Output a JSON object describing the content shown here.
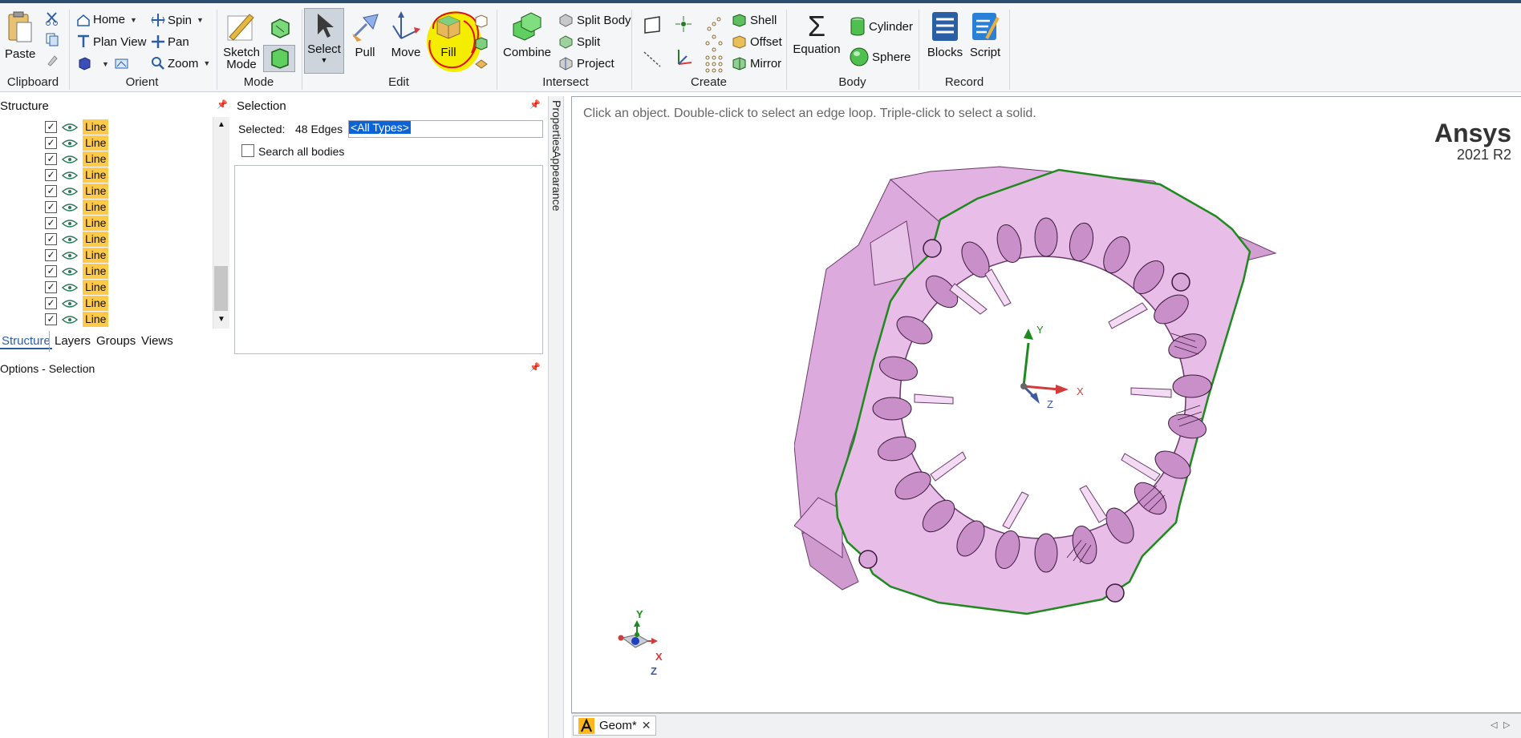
{
  "ribbon": {
    "clipboard": {
      "label": "Clipboard",
      "paste": "Paste"
    },
    "orient": {
      "label": "Orient",
      "home": "Home",
      "spin": "Spin",
      "plan_view": "Plan View",
      "pan": "Pan",
      "zoom": "Zoom"
    },
    "mode": {
      "label": "Mode",
      "sketch_mode": "Sketch\nMode"
    },
    "edit": {
      "label": "Edit",
      "select": "Select",
      "pull": "Pull",
      "move": "Move",
      "fill": "Fill"
    },
    "intersect": {
      "label": "Intersect",
      "combine": "Combine",
      "split_body": "Split Body",
      "split": "Split",
      "project": "Project"
    },
    "create": {
      "label": "Create",
      "shell": "Shell",
      "offset": "Offset",
      "mirror": "Mirror"
    },
    "body": {
      "label": "Body",
      "equation": "Equation",
      "cylinder": "Cylinder",
      "sphere": "Sphere"
    },
    "record": {
      "label": "Record",
      "blocks": "Blocks",
      "script": "Script"
    }
  },
  "structure": {
    "title": "Structure",
    "items": [
      "Line",
      "Line",
      "Line",
      "Line",
      "Line",
      "Line",
      "Line",
      "Line",
      "Line",
      "Line",
      "Line",
      "Line",
      "Line"
    ],
    "tabs": [
      "Structure",
      "Layers",
      "Groups",
      "Views"
    ]
  },
  "selection": {
    "title": "Selection",
    "selected_label": "Selected:",
    "selected_value": "48 Edges",
    "type_filter": "<All Types>",
    "search_all_bodies": "Search all bodies"
  },
  "side_tabs": [
    "Properties",
    "Appearance"
  ],
  "options_title": "Options - Selection",
  "viewport": {
    "hint": "Click an object. Double-click to select an edge loop. Triple-click to select a solid.",
    "brand": "Ansys",
    "version": "2021 R2",
    "axis_labels": {
      "x": "X",
      "y": "Y",
      "z": "Z"
    }
  },
  "document_tab": {
    "name": "Geom*"
  },
  "colors": {
    "part_fill": "#e8bde8",
    "part_side": "#d49ed4",
    "edge_highlight": "#1e8a1e",
    "annotation": "#f5ed00",
    "annotation_ring": "#e01010",
    "line_tag": "#ffc94a"
  }
}
